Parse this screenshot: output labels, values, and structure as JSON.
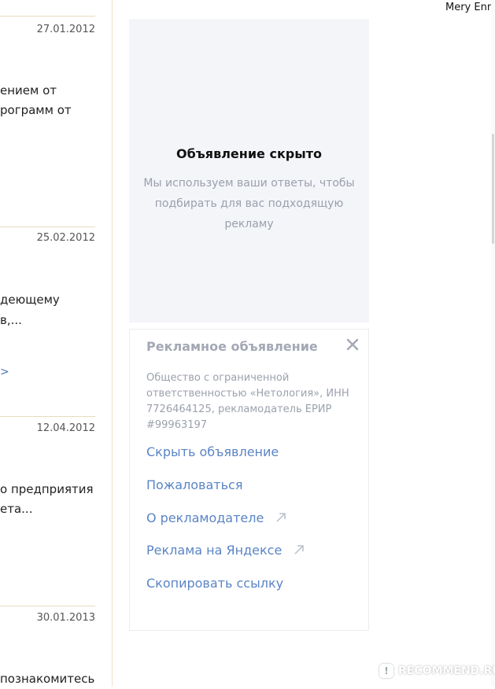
{
  "header": {
    "user_name": "Mery Enn"
  },
  "entries": [
    {
      "date": "27.01.2012",
      "lines": [
        "ением от",
        "рограмм от"
      ],
      "link": ""
    },
    {
      "date": "25.02.2012",
      "lines": [
        "деющему",
        "в,..."
      ],
      "link": ">"
    },
    {
      "date": "12.04.2012",
      "lines": [
        "о предприятия",
        "ета..."
      ],
      "link": ""
    },
    {
      "date": "30.01.2013",
      "lines": [
        "познакомитесь"
      ],
      "link": ""
    }
  ],
  "hidden_ad": {
    "title": "Объявление скрыто",
    "desc_lines": [
      "Мы используем ваши ответы, чтобы",
      "подбирать для вас подходящую",
      "рекламу"
    ]
  },
  "ad_panel": {
    "title": "Рекламное объявление",
    "info_lines": [
      "Общество с ограниченной",
      "ответственностью «Нетология», ИНН",
      "7726464125, рекламодатель ЕРИР",
      "#99963197"
    ],
    "actions": {
      "hide": "Скрыть объявление",
      "report": "Пожаловаться",
      "advertiser": "О рекламодателе",
      "yandex": "Реклама на Яндексе",
      "copy": "Скопировать ссылку"
    }
  },
  "watermark": {
    "text": "RECOMMEND.RU"
  },
  "colors": {
    "link": "#5a84c6",
    "muted": "#9ca1ad",
    "panel_bg": "#f4f5f9",
    "divider": "#efe3c9"
  }
}
